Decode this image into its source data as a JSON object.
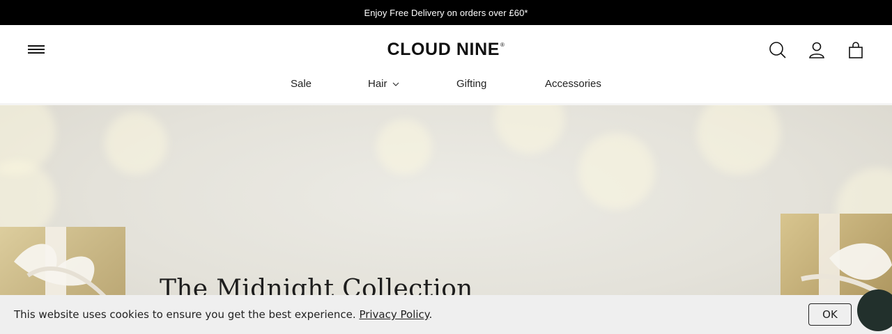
{
  "announcement": {
    "text": "Enjoy Free Delivery on orders over £60*"
  },
  "header": {
    "brand": "CLOUD NINE",
    "brand_mark": "®",
    "icons": {
      "menu": "hamburger-menu-icon",
      "search": "search-icon",
      "account": "account-icon",
      "bag": "shopping-bag-icon"
    }
  },
  "nav": {
    "items": [
      {
        "label": "Sale"
      },
      {
        "label": "Hair",
        "has_dropdown": true
      },
      {
        "label": "Gifting"
      },
      {
        "label": "Accessories"
      }
    ]
  },
  "hero": {
    "title": "The Midnight Collection"
  },
  "cookie": {
    "text": "This website uses cookies to ensure you get the best experience.",
    "link": "Privacy Policy",
    "suffix": ".",
    "ok_label": "OK"
  }
}
